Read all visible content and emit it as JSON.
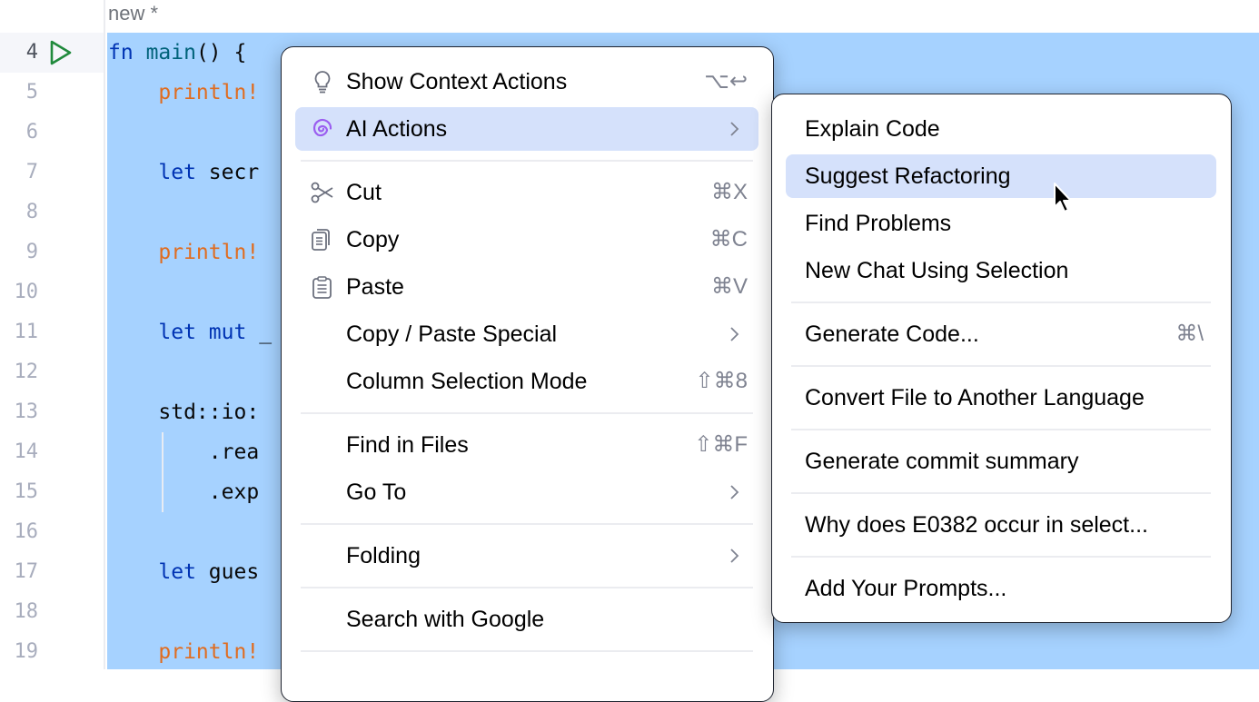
{
  "editor": {
    "tab_title": "new *",
    "current_line": 4,
    "line_numbers": [
      "4",
      "5",
      "6",
      "7",
      "8",
      "9",
      "10",
      "11",
      "12",
      "13",
      "14",
      "15",
      "16",
      "17",
      "18",
      "19"
    ],
    "code_lines": [
      {
        "line": 4,
        "parts": [
          [
            "kw",
            "fn"
          ],
          [
            "plain",
            " "
          ],
          [
            "fn",
            "main"
          ],
          [
            "plain",
            "() {"
          ]
        ]
      },
      {
        "line": 5,
        "parts": [
          [
            "plain",
            "    "
          ],
          [
            "mac",
            "println!"
          ]
        ]
      },
      {
        "line": 7,
        "parts": [
          [
            "plain",
            "    "
          ],
          [
            "kw",
            "let"
          ],
          [
            "plain",
            " secr"
          ]
        ]
      },
      {
        "line": 9,
        "parts": [
          [
            "plain",
            "    "
          ],
          [
            "mac",
            "println!"
          ]
        ]
      },
      {
        "line": 11,
        "parts": [
          [
            "plain",
            "    "
          ],
          [
            "kw",
            "let"
          ],
          [
            "plain",
            " "
          ],
          [
            "kw",
            "mut"
          ],
          [
            "plain",
            " _"
          ]
        ]
      },
      {
        "line": 13,
        "parts": [
          [
            "plain",
            "    std::io:"
          ]
        ]
      },
      {
        "line": 14,
        "parts": [
          [
            "plain",
            "        .rea"
          ]
        ]
      },
      {
        "line": 15,
        "parts": [
          [
            "plain",
            "        .exp"
          ]
        ]
      },
      {
        "line": 17,
        "parts": [
          [
            "plain",
            "    "
          ],
          [
            "kw",
            "let"
          ],
          [
            "plain",
            " gues"
          ]
        ]
      },
      {
        "line": 19,
        "parts": [
          [
            "plain",
            "    "
          ],
          [
            "mac",
            "println!"
          ]
        ]
      }
    ]
  },
  "context_menu": {
    "items": [
      {
        "label": "Show Context Actions",
        "shortcut": "⌥↩",
        "icon": "lightbulb-icon"
      },
      {
        "label": "AI Actions",
        "submenu": true,
        "highlighted": true,
        "icon": "ai-spiral-icon"
      },
      {
        "label": "Cut",
        "shortcut": "⌘X",
        "icon": "scissors-icon"
      },
      {
        "label": "Copy",
        "shortcut": "⌘C",
        "icon": "copy-icon"
      },
      {
        "label": "Paste",
        "shortcut": "⌘V",
        "icon": "clipboard-icon"
      },
      {
        "label": "Copy / Paste Special",
        "submenu": true
      },
      {
        "label": "Column Selection Mode",
        "shortcut": "⇧⌘8"
      },
      {
        "label": "Find in Files",
        "shortcut": "⇧⌘F"
      },
      {
        "label": "Go To",
        "submenu": true
      },
      {
        "label": "Folding",
        "submenu": true
      },
      {
        "label": "Search with Google"
      }
    ]
  },
  "ai_submenu": {
    "items": [
      {
        "label": "Explain Code"
      },
      {
        "label": "Suggest Refactoring",
        "highlighted": true
      },
      {
        "label": "Find Problems"
      },
      {
        "label": "New Chat Using Selection"
      },
      {
        "label": "Generate Code...",
        "shortcut": "⌘\\"
      },
      {
        "label": "Convert File to Another Language"
      },
      {
        "label": "Generate commit summary"
      },
      {
        "label": "Why does E0382 occur in select..."
      },
      {
        "label": "Add Your Prompts..."
      }
    ]
  },
  "colors": {
    "selection": "#a6d2ff",
    "menu_highlight": "#d5e1fb",
    "keyword": "#0033b3",
    "function": "#00627a",
    "macro": "#e06c1f",
    "run_icon": "#208a3c",
    "ai_icon": "#9b5ef0"
  }
}
